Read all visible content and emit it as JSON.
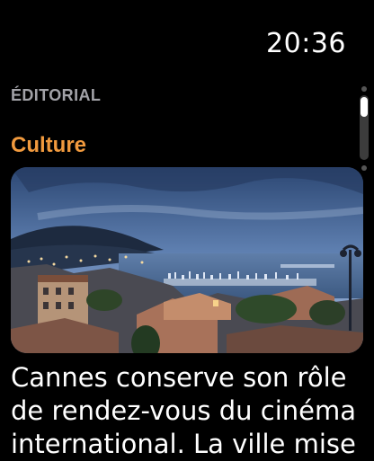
{
  "status_bar": {
    "time": "20:36"
  },
  "section": {
    "label": "ÉDITORIAL"
  },
  "article": {
    "category": "Culture",
    "category_color": "#f19a3e",
    "image_description": "Vue panoramique de Cannes au crépuscule avec le port et les toits",
    "headline": "Cannes conserve son rôle de rendez-vous du cinéma international. La ville mise"
  },
  "scroll": {
    "position": 0.1
  }
}
